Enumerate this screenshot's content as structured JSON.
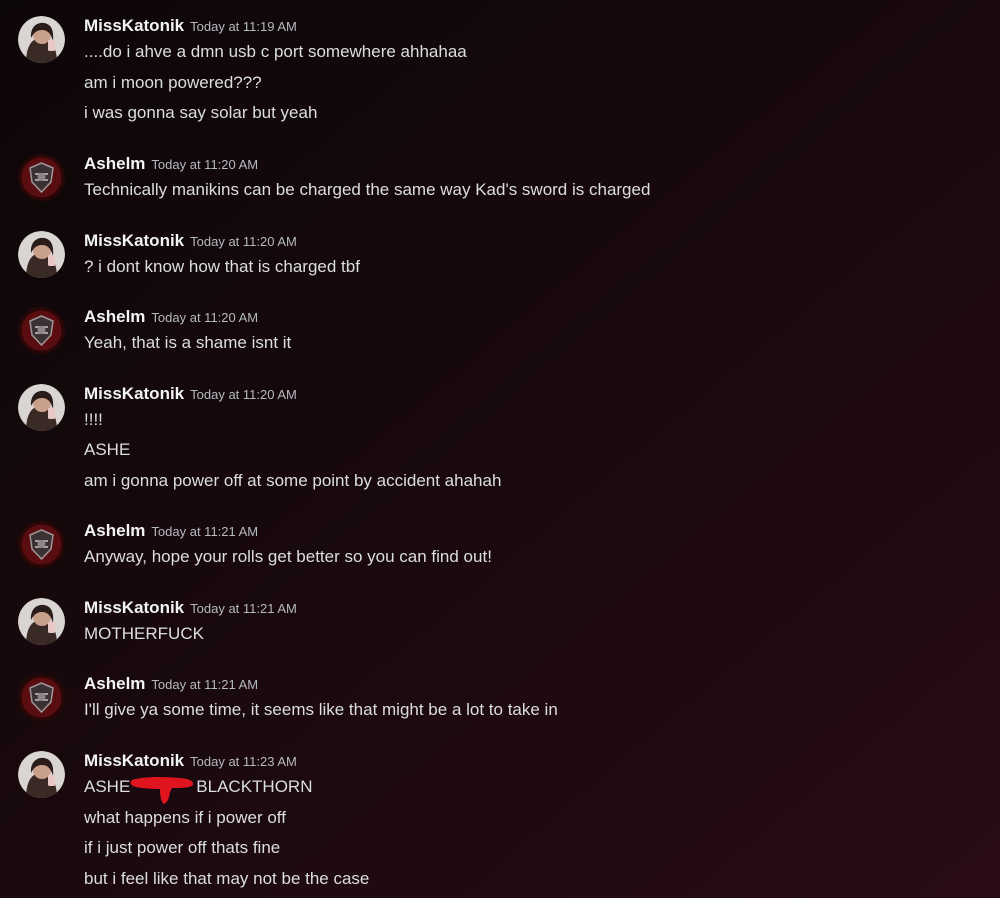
{
  "users": {
    "miss": {
      "name": "MissKatonik"
    },
    "ashelm": {
      "name": "Ashelm"
    }
  },
  "colors": {
    "background": "#15080b",
    "author": "#f2f3f5",
    "text": "#dbdee1",
    "timestamp": "#b5bac1",
    "redaction": "#e0141e"
  },
  "messages": [
    {
      "author": "MissKatonik",
      "time": "Today at 11:19 AM",
      "lines": [
        "....do i ahve a dmn usb c port somewhere ahhahaa",
        "am i moon powered???",
        "i was gonna say solar but yeah"
      ]
    },
    {
      "author": "Ashelm",
      "time": "Today at 11:20 AM",
      "lines": [
        "Technically manikins can be charged the same way Kad's sword is charged"
      ]
    },
    {
      "author": "MissKatonik",
      "time": "Today at 11:20 AM",
      "lines": [
        "? i dont know how that is charged tbf"
      ]
    },
    {
      "author": "Ashelm",
      "time": "Today at 11:20 AM",
      "lines": [
        "Yeah, that is a shame isnt it"
      ]
    },
    {
      "author": "MissKatonik",
      "time": "Today at 11:20 AM",
      "lines": [
        "!!!!",
        "ASHE",
        "am i gonna power off at some point by accident ahahah"
      ]
    },
    {
      "author": "Ashelm",
      "time": "Today at 11:21 AM",
      "lines": [
        "Anyway, hope your rolls get better so you can find out!"
      ]
    },
    {
      "author": "MissKatonik",
      "time": "Today at 11:21 AM",
      "lines": [
        "MOTHERFUCK"
      ]
    },
    {
      "author": "Ashelm",
      "time": "Today at 11:21 AM",
      "lines": [
        "I'll give ya some time, it seems like that might be a lot to take in"
      ]
    },
    {
      "author": "MissKatonik",
      "time": "Today at 11:23 AM",
      "lines": [
        "ASHE",
        "BLACKTHORN",
        "what happens if i power off",
        "if i just power off thats fine",
        "but i feel like that may not be the case"
      ]
    }
  ]
}
